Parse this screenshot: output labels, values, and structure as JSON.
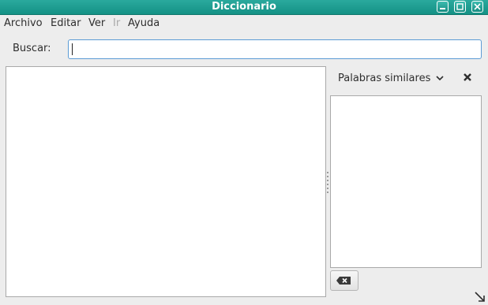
{
  "window": {
    "title": "Diccionario"
  },
  "menu": {
    "items": [
      {
        "label": "Archivo",
        "enabled": true
      },
      {
        "label": "Editar",
        "enabled": true
      },
      {
        "label": "Ver",
        "enabled": true
      },
      {
        "label": "Ir",
        "enabled": false
      },
      {
        "label": "Ayuda",
        "enabled": true
      }
    ]
  },
  "search": {
    "label": "Buscar:",
    "value": ""
  },
  "sidebar": {
    "title": "Palabras similares",
    "items": []
  },
  "icons": {
    "minimize": "minimize-icon",
    "maximize": "maximize-icon",
    "close_window": "close-icon",
    "dropdown": "chevron-down-icon",
    "close_panel": "close-icon",
    "clear": "backspace-icon",
    "resize": "resize-grip-icon"
  },
  "colors": {
    "titlebar": "#149185",
    "focus_border": "#5b9bd5",
    "disabled_text": "#a9a9a9"
  }
}
